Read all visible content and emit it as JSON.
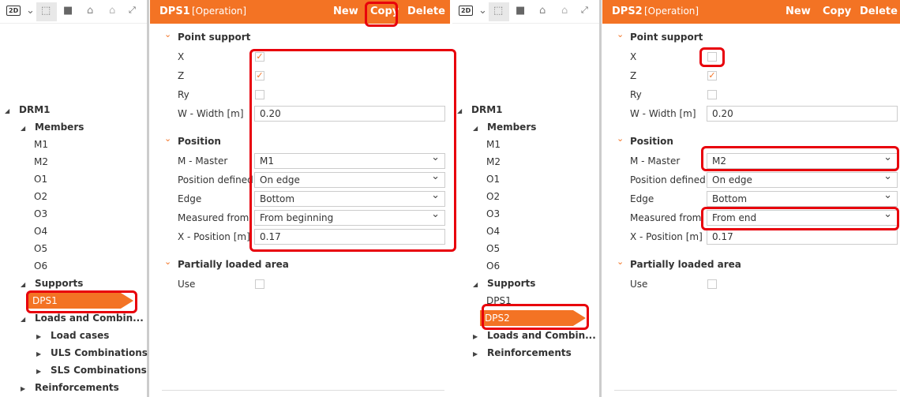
{
  "colors": {
    "accent": "#f37324",
    "highlight": "#e8000b"
  },
  "toolbar": {
    "mode_label": "2D",
    "icons": [
      "dropdown-chevron-icon",
      "wireframe-cube-icon",
      "solid-cube-icon",
      "section-view-icon",
      "home-icon",
      "fullscreen-icon"
    ]
  },
  "panels": [
    {
      "header": {
        "title": "DPS1",
        "subtitle": "[Operation]",
        "new": "New",
        "copy": "Copy",
        "delete": "Delete"
      },
      "tree": [
        {
          "label": "DRM1",
          "bold": true,
          "lvl": 0,
          "arrow": "open"
        },
        {
          "label": "Members",
          "bold": true,
          "lvl": 1,
          "arrow": "open"
        },
        {
          "label": "M1",
          "lvl": 2
        },
        {
          "label": "M2",
          "lvl": 2
        },
        {
          "label": "O1",
          "lvl": 2
        },
        {
          "label": "O2",
          "lvl": 2
        },
        {
          "label": "O3",
          "lvl": 2
        },
        {
          "label": "O4",
          "lvl": 2
        },
        {
          "label": "O5",
          "lvl": 2
        },
        {
          "label": "O6",
          "lvl": 2
        },
        {
          "label": "Supports",
          "bold": true,
          "lvl": 1,
          "arrow": "open"
        },
        {
          "label": "DPS1",
          "lvl": 2,
          "selected": true
        },
        {
          "label": "Loads and Combin...",
          "bold": true,
          "lvl": 1,
          "arrow": "open"
        },
        {
          "label": "Load cases",
          "bold": true,
          "lvl": 2,
          "arrow": "closed"
        },
        {
          "label": "ULS Combinations",
          "bold": true,
          "lvl": 2,
          "arrow": "closed"
        },
        {
          "label": "SLS Combinations",
          "bold": true,
          "lvl": 2,
          "arrow": "closed"
        },
        {
          "label": "Reinforcements",
          "bold": true,
          "lvl": 1,
          "arrow": "closed"
        }
      ],
      "form": {
        "point_support": "Point support",
        "x_label": "X",
        "x_checked": true,
        "z_label": "Z",
        "z_checked": true,
        "ry_label": "Ry",
        "ry_checked": false,
        "width_label": "W - Width [m]",
        "width_value": "0.20",
        "position": "Position",
        "master_label": "M - Master",
        "master_value": "M1",
        "posdef_label": "Position defined",
        "posdef_value": "On edge",
        "edge_label": "Edge",
        "edge_value": "Bottom",
        "measured_label": "Measured from",
        "measured_value": "From beginning",
        "xpos_label": "X - Position [m]",
        "xpos_value": "0.17",
        "partial": "Partially loaded area",
        "use_label": "Use",
        "use_checked": false
      }
    },
    {
      "header": {
        "title": "DPS2",
        "subtitle": "[Operation]",
        "new": "New",
        "copy": "Copy",
        "delete": "Delete"
      },
      "tree": [
        {
          "label": "DRM1",
          "bold": true,
          "lvl": 0,
          "arrow": "open"
        },
        {
          "label": "Members",
          "bold": true,
          "lvl": 1,
          "arrow": "open"
        },
        {
          "label": "M1",
          "lvl": 2
        },
        {
          "label": "M2",
          "lvl": 2
        },
        {
          "label": "O1",
          "lvl": 2
        },
        {
          "label": "O2",
          "lvl": 2
        },
        {
          "label": "O3",
          "lvl": 2
        },
        {
          "label": "O4",
          "lvl": 2
        },
        {
          "label": "O5",
          "lvl": 2
        },
        {
          "label": "O6",
          "lvl": 2
        },
        {
          "label": "Supports",
          "bold": true,
          "lvl": 1,
          "arrow": "open"
        },
        {
          "label": "DPS1",
          "lvl": 2
        },
        {
          "label": "DPS2",
          "lvl": 2,
          "selected": true
        },
        {
          "label": "Loads and Combin...",
          "bold": true,
          "lvl": 1,
          "arrow": "closed"
        },
        {
          "label": "Reinforcements",
          "bold": true,
          "lvl": 1,
          "arrow": "closed"
        }
      ],
      "form": {
        "point_support": "Point support",
        "x_label": "X",
        "x_checked": false,
        "z_label": "Z",
        "z_checked": true,
        "ry_label": "Ry",
        "ry_checked": false,
        "width_label": "W - Width [m]",
        "width_value": "0.20",
        "position": "Position",
        "master_label": "M - Master",
        "master_value": "M2",
        "posdef_label": "Position defined",
        "posdef_value": "On edge",
        "edge_label": "Edge",
        "edge_value": "Bottom",
        "measured_label": "Measured from",
        "measured_value": "From end",
        "xpos_label": "X - Position [m]",
        "xpos_value": "0.17",
        "partial": "Partially loaded area",
        "use_label": "Use",
        "use_checked": false
      }
    }
  ]
}
